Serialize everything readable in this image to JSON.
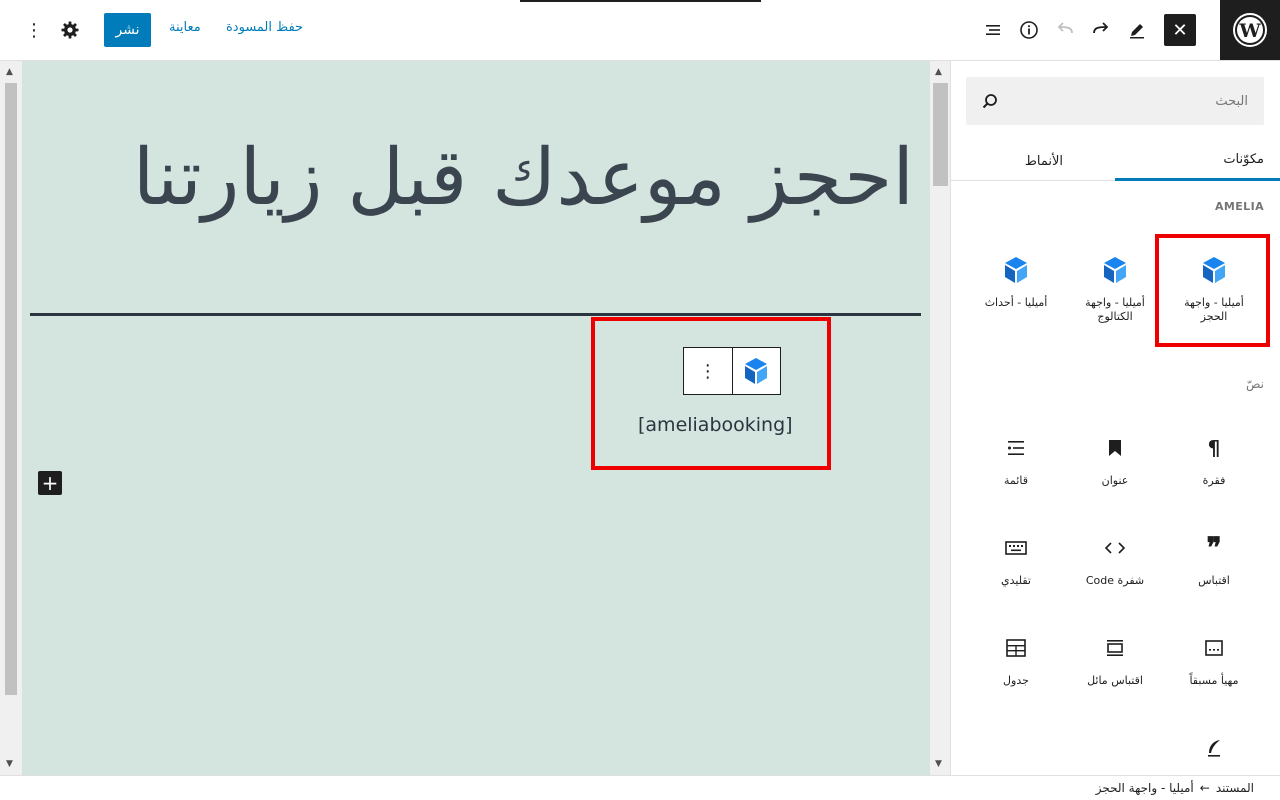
{
  "toolbar": {
    "publish_label": "نشر",
    "preview_label": "معاينة",
    "save_draft_label": "حفظ المسودة",
    "close_label": "✕",
    "more_label": "⋮"
  },
  "sidebar": {
    "search_placeholder": "البحث",
    "tabs": [
      {
        "label": "مكوّنات",
        "active": true
      },
      {
        "label": "الأنماط",
        "active": false
      }
    ],
    "sections": [
      {
        "title": "AMELIA",
        "items": [
          {
            "label": "أميليا - واجهة الحجز",
            "icon": "amelia-cube-icon",
            "highlighted": true
          },
          {
            "label": "أميليا - واجهة الكتالوج",
            "icon": "amelia-cube-icon"
          },
          {
            "label": "أميليا - أحداث",
            "icon": "amelia-cube-icon"
          }
        ]
      },
      {
        "title": "نصّ",
        "items": [
          {
            "label": "فقرة",
            "icon": "paragraph-icon"
          },
          {
            "label": "عنوان",
            "icon": "bookmark-icon"
          },
          {
            "label": "قائمة",
            "icon": "list-icon"
          },
          {
            "label": "اقتباس",
            "icon": "quote-icon"
          },
          {
            "label": "شفرة Code",
            "icon": "code-icon"
          },
          {
            "label": "تقليدي",
            "icon": "keyboard-icon"
          },
          {
            "label": "مهيأ مسبقاً",
            "icon": "preformatted-icon"
          },
          {
            "label": "اقتباس مائل",
            "icon": "pullquote-icon"
          },
          {
            "label": "جدول",
            "icon": "table-icon"
          }
        ]
      }
    ]
  },
  "canvas": {
    "title": "احجز موعدك قبل زيارتنا",
    "shortcode": "[ameliabooking]",
    "block_more_label": "⋮",
    "add_block_label": "+"
  },
  "footer": {
    "breadcrumb_root": "المستند",
    "breadcrumb_sep": "←",
    "breadcrumb_current": "أميليا - واجهة الحجز"
  },
  "colors": {
    "accent": "#007cba",
    "canvas_bg": "#d4e5df",
    "amelia_blue": "#1a84ee",
    "highlight": "#ee0000",
    "dark": "#1e1e1e"
  }
}
